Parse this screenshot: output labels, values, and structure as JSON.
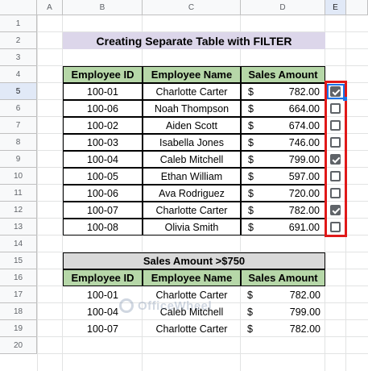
{
  "columns": [
    "A",
    "B",
    "C",
    "D",
    "E"
  ],
  "rows": [
    "1",
    "2",
    "3",
    "4",
    "5",
    "6",
    "7",
    "8",
    "9",
    "10",
    "11",
    "12",
    "13",
    "14",
    "15",
    "16",
    "17",
    "18",
    "19",
    "20"
  ],
  "active_cell": {
    "column": "E",
    "row": "5"
  },
  "title": "Creating Separate Table with FILTER",
  "main_table": {
    "headers": [
      "Employee ID",
      "Employee Name",
      "Sales Amount"
    ],
    "currency_symbol": "$",
    "rows": [
      {
        "id": "100-01",
        "name": "Charlotte Carter",
        "amount": "782.00",
        "checked": true
      },
      {
        "id": "100-06",
        "name": "Noah Thompson",
        "amount": "664.00",
        "checked": false
      },
      {
        "id": "100-02",
        "name": "Aiden Scott",
        "amount": "674.00",
        "checked": false
      },
      {
        "id": "100-03",
        "name": "Isabella Jones",
        "amount": "746.00",
        "checked": false
      },
      {
        "id": "100-04",
        "name": "Caleb Mitchell",
        "amount": "799.00",
        "checked": true
      },
      {
        "id": "100-05",
        "name": "Ethan William",
        "amount": "597.00",
        "checked": false
      },
      {
        "id": "100-06",
        "name": "Ava Rodriguez",
        "amount": "720.00",
        "checked": false
      },
      {
        "id": "100-07",
        "name": "Charlotte Carter",
        "amount": "782.00",
        "checked": true
      },
      {
        "id": "100-08",
        "name": "Olivia Smith",
        "amount": "691.00",
        "checked": false
      }
    ]
  },
  "filter_table": {
    "title": "Sales Amount >$750",
    "headers": [
      "Employee ID",
      "Employee Name",
      "Sales Amount"
    ],
    "currency_symbol": "$",
    "rows": [
      {
        "id": "100-01",
        "name": "Charlotte Carter",
        "amount": "782.00"
      },
      {
        "id": "100-04",
        "name": "Caleb Mitchell",
        "amount": "799.00"
      },
      {
        "id": "100-07",
        "name": "Charlotte Carter",
        "amount": "782.00"
      }
    ]
  },
  "watermark": "OfficeWheel",
  "colors": {
    "title_bg": "#dcd6ea",
    "header_green": "#b6d7a8",
    "header_gray": "#d9d9d9",
    "highlight_red": "#e01919",
    "selection_blue": "#1a73e8"
  }
}
